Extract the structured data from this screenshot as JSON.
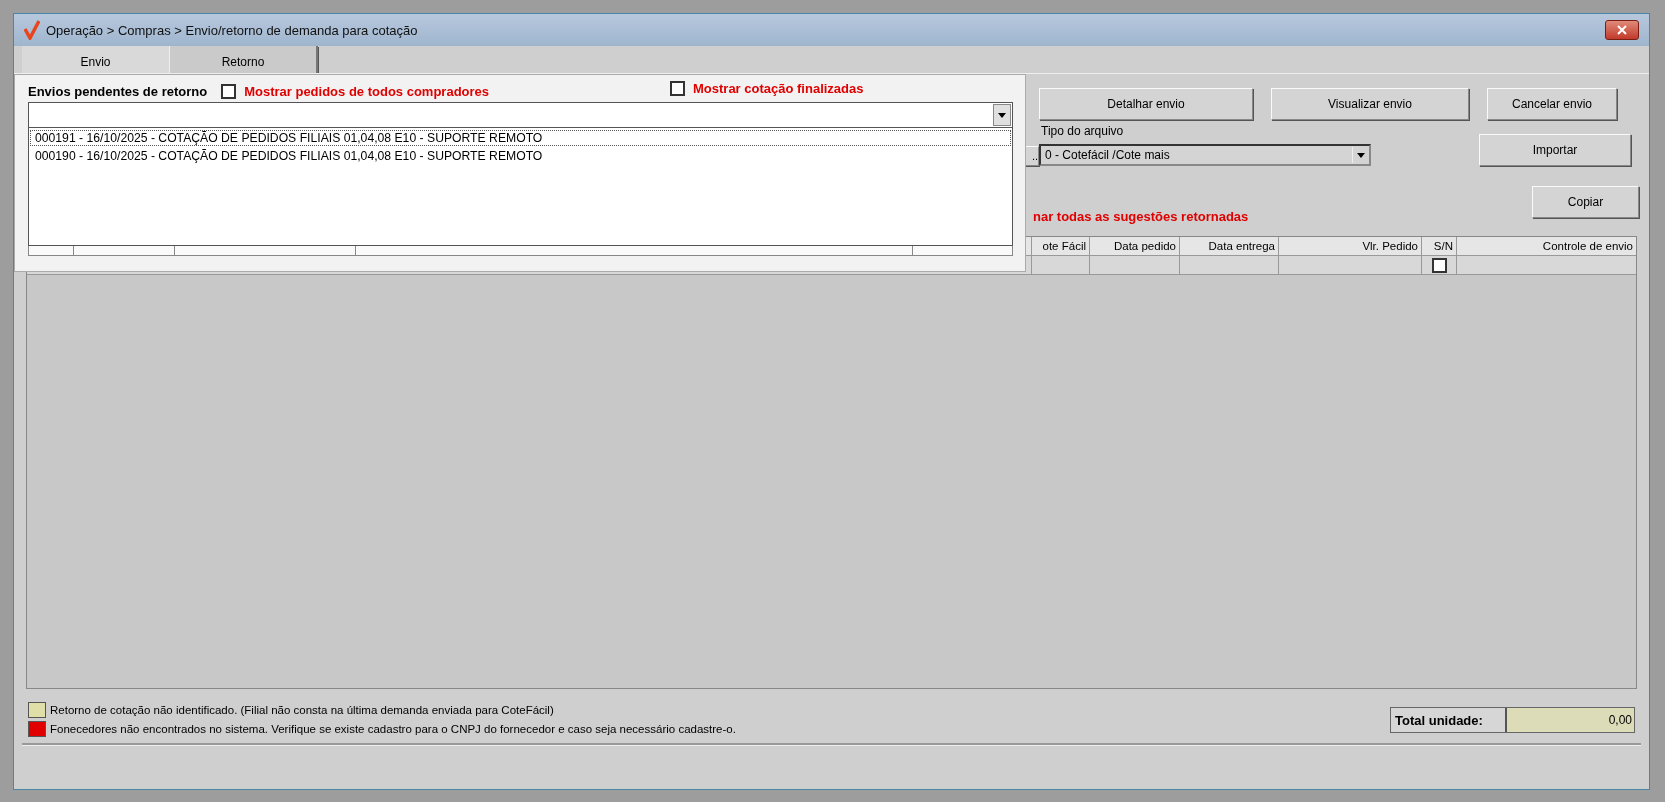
{
  "window": {
    "title": "Operação > Compras > Envio/retorno de demanda para cotação"
  },
  "tabs": [
    {
      "label": "Envio",
      "selected": false
    },
    {
      "label": "Retorno",
      "selected": true
    }
  ],
  "toolbar_buttons": [
    {
      "label": "Detalhar envio"
    },
    {
      "label": "Visualizar envio"
    },
    {
      "label": "Cancelar envio"
    }
  ],
  "ellipsis_button": "..",
  "file_type": {
    "label": "Tipo do arquivo",
    "value": "0 - Cotefácil /Cote mais"
  },
  "import_button": "Importar",
  "select_all_text": "nar todas as sugestões retornadas",
  "copy_button": "Copiar",
  "table": {
    "columns": [
      "ote Fácil",
      "Data pedido",
      "Data entrega",
      "Vlr. Pedido",
      "S/N",
      "Controle de envio"
    ],
    "rows": [
      {
        "checked": false
      }
    ]
  },
  "pending": {
    "label": "Envios pendentes de retorno",
    "show_all_buyers": {
      "label": "Mostrar pedidos de todos compradores",
      "checked": false
    },
    "show_finished": {
      "label": "Mostrar cotação finalizadas",
      "checked": false
    },
    "items": [
      {
        "text": "000191 - 16/10/2025 - COTAÇÃO DE PEDIDOS FILIAIS 01,04,08 E10 - SUPORTE REMOTO",
        "selected": true
      },
      {
        "text": "000190 - 16/10/2025 - COTAÇÃO DE PEDIDOS FILIAIS 01,04,08 E10 - SUPORTE REMOTO",
        "selected": false
      }
    ]
  },
  "legend": [
    {
      "color": "#e0dfa8",
      "text": "Retorno de cotação não identificado. (Filial não consta na última demanda enviada para CoteFácil)"
    },
    {
      "color": "#e00000",
      "text": "Fonecedores não encontrados no sistema. Verifique se existe cadastro para o CNPJ do fornecedor e caso seja necessário cadastre-o."
    }
  ],
  "total": {
    "label": "Total unidade:",
    "value": "0,00"
  }
}
